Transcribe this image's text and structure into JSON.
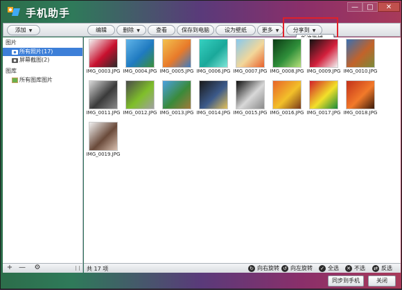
{
  "window": {
    "title": "手机助手",
    "min_label": "—",
    "max_label": "□",
    "close_label": "✕"
  },
  "toolbar": {
    "add_label": "添加",
    "edit_label": "编辑",
    "delete_label": "删除",
    "view_label": "查看",
    "save_to_pc_label": "保存到电脑",
    "set_wallpaper_label": "设为壁纸",
    "more_label": "更多",
    "share_label": "分享到",
    "share_menu_items": [
      "新浪微博"
    ]
  },
  "sidebar": {
    "groups": [
      {
        "label": "图片",
        "items": [
          {
            "label": "所有照片(17)",
            "selected": true
          },
          {
            "label": "屏幕截图(2)",
            "selected": false
          }
        ]
      },
      {
        "label": "图库",
        "items": [
          {
            "label": "所有图库图片",
            "selected": false
          }
        ]
      }
    ],
    "footer": {
      "add": "+",
      "remove": "—",
      "settings": "⚙"
    }
  },
  "photos": [
    {
      "name": "IMG_0003.JPG",
      "colors": [
        "#f2f2f2",
        "#c8102e",
        "#2a2a2a"
      ]
    },
    {
      "name": "IMG_0004.JPG",
      "colors": [
        "#5fb3e8",
        "#1f7ac0",
        "#3a8f3a"
      ]
    },
    {
      "name": "IMG_0005.JPG",
      "colors": [
        "#f2c14e",
        "#e87a2a",
        "#3e7bbf"
      ]
    },
    {
      "name": "IMG_0006.JPG",
      "colors": [
        "#35d0c0",
        "#1aa89a",
        "#7ee6d8"
      ]
    },
    {
      "name": "IMG_0007.JPG",
      "colors": [
        "#87c9ee",
        "#f2d79a",
        "#e8612c"
      ]
    },
    {
      "name": "IMG_0008.JPG",
      "colors": [
        "#0b3a14",
        "#2f8f3a",
        "#b6e07a"
      ]
    },
    {
      "name": "IMG_0009.JPG",
      "colors": [
        "#111111",
        "#d3203c",
        "#f2f2f2"
      ]
    },
    {
      "name": "IMG_0010.JPG",
      "colors": [
        "#3a6fb0",
        "#c2632a",
        "#7a8a3a"
      ]
    },
    {
      "name": "IMG_0011.JPG",
      "colors": [
        "#d8d8d8",
        "#3a3a3a",
        "#8a8a8a"
      ]
    },
    {
      "name": "IMG_0012.JPG",
      "colors": [
        "#4a4a4a",
        "#7fbf2a",
        "#a0a0a0"
      ]
    },
    {
      "name": "IMG_0013.JPG",
      "colors": [
        "#4aa0e0",
        "#3a8a3a",
        "#a07a3a"
      ]
    },
    {
      "name": "IMG_0014.JPG",
      "colors": [
        "#1a1a1a",
        "#3c5a8a",
        "#e3c15a"
      ]
    },
    {
      "name": "IMG_0015.JPG",
      "colors": [
        "#0d0d0d",
        "#d8d8d8",
        "#8a8a8a"
      ]
    },
    {
      "name": "IMG_0016.JPG",
      "colors": [
        "#e8642a",
        "#f2c02a",
        "#7a3a1a"
      ]
    },
    {
      "name": "IMG_0017.JPG",
      "colors": [
        "#d21f2a",
        "#f2e02a",
        "#1a8a3a"
      ]
    },
    {
      "name": "IMG_0018.JPG",
      "colors": [
        "#c2311a",
        "#f27a2a",
        "#3a1a0a"
      ]
    },
    {
      "name": "IMG_0019.JPG",
      "colors": [
        "#f0f0f0",
        "#6a4a3a",
        "#d8c0b0"
      ]
    }
  ],
  "status": {
    "count_text": "共 17 项",
    "rotate_right_label": "向右旋转",
    "rotate_left_label": "向左旋转",
    "select_all_label": "全选",
    "select_none_label": "不选",
    "invert_label": "反选"
  },
  "bottom": {
    "sync_label": "同步到手机",
    "close_label": "关闭"
  },
  "colors": {
    "accent": "#3d7fd8",
    "highlight": "#e0202a"
  }
}
